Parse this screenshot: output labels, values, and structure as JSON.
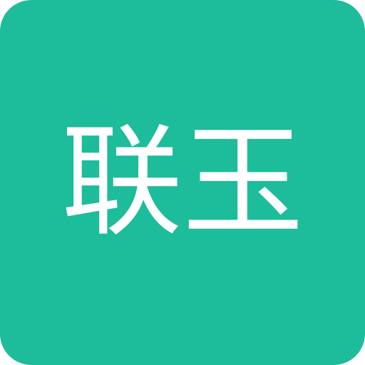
{
  "icon": {
    "label": "联玉",
    "background_color": "#1DBC9A",
    "text_color": "#FFFFFF"
  }
}
